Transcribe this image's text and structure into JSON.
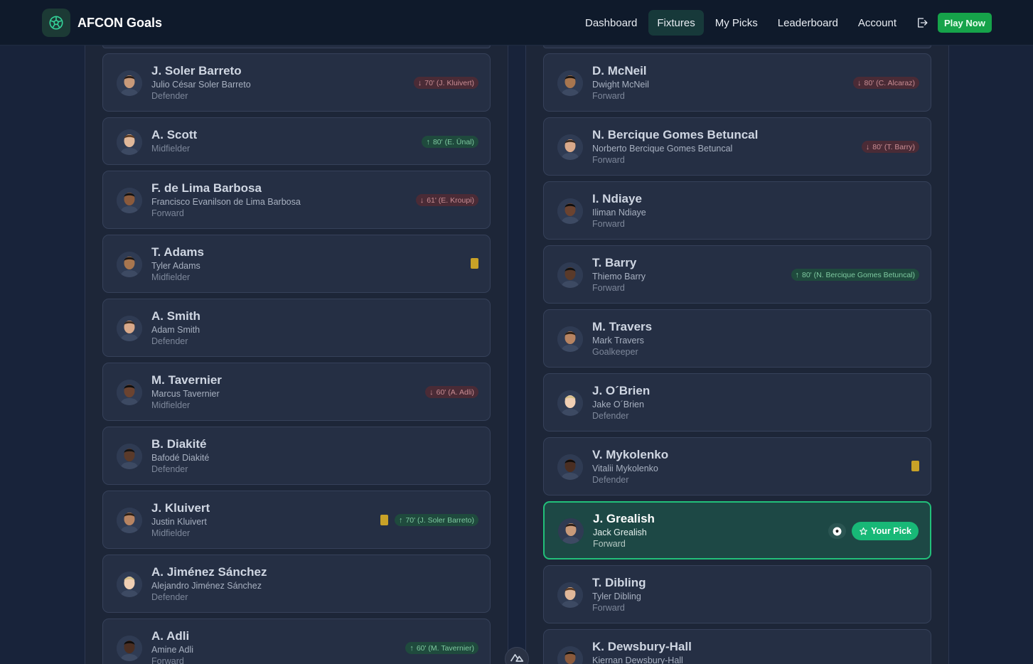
{
  "app": {
    "title": "AFCON Goals",
    "logo_icon": "soccer-ball-icon"
  },
  "nav": {
    "items": [
      {
        "label": "Dashboard",
        "active": false
      },
      {
        "label": "Fixtures",
        "active": true
      },
      {
        "label": "My Picks",
        "active": false
      },
      {
        "label": "Leaderboard",
        "active": false
      },
      {
        "label": "Account",
        "active": false
      }
    ],
    "logout_icon": "logout-icon",
    "cta_label": "Play Now"
  },
  "colors": {
    "accent": "#16a34a",
    "pick_border": "#22c07a",
    "sub_out": "#c98d93",
    "sub_in": "#7ec9a0",
    "yellow_card": "#c9a227"
  },
  "left_team": {
    "players": [
      {
        "name": "J. Soler Barreto",
        "full": "Julio César Soler Barreto",
        "position": "Defender",
        "yellow": false,
        "sub": {
          "type": "out",
          "text": "70' (J. Kluivert)"
        }
      },
      {
        "name": "A. Scott",
        "full": "",
        "position": "Midfielder",
        "yellow": false,
        "sub": {
          "type": "in",
          "text": "80' (E. Ünal)"
        }
      },
      {
        "name": "F. de Lima Barbosa",
        "full": "Francisco Evanilson de Lima Barbosa",
        "position": "Forward",
        "yellow": false,
        "sub": {
          "type": "out",
          "text": "61' (E. Kroupi)"
        }
      },
      {
        "name": "T. Adams",
        "full": "Tyler Adams",
        "position": "Midfielder",
        "yellow": true,
        "sub": null
      },
      {
        "name": "A. Smith",
        "full": "Adam Smith",
        "position": "Defender",
        "yellow": false,
        "sub": null
      },
      {
        "name": "M. Tavernier",
        "full": "Marcus Tavernier",
        "position": "Midfielder",
        "yellow": false,
        "sub": {
          "type": "out",
          "text": "60' (A. Adli)"
        }
      },
      {
        "name": "B. Diakité",
        "full": "Bafodé Diakité",
        "position": "Defender",
        "yellow": false,
        "sub": null
      },
      {
        "name": "J. Kluivert",
        "full": "Justin Kluivert",
        "position": "Midfielder",
        "yellow": true,
        "sub": {
          "type": "in",
          "text": "70' (J. Soler Barreto)"
        }
      },
      {
        "name": "A. Jiménez Sánchez",
        "full": "Alejandro Jiménez Sánchez",
        "position": "Defender",
        "yellow": false,
        "sub": null
      },
      {
        "name": "A. Adli",
        "full": "Amine Adli",
        "position": "Forward",
        "yellow": false,
        "sub": {
          "type": "in",
          "text": "60' (M. Tavernier)"
        }
      }
    ]
  },
  "right_team": {
    "players": [
      {
        "name": "D. McNeil",
        "full": "Dwight McNeil",
        "position": "Forward",
        "yellow": false,
        "sub": {
          "type": "out",
          "text": "80' (C. Alcaraz)"
        }
      },
      {
        "name": "N. Bercique Gomes Betuncal",
        "full": "Norberto Bercique Gomes Betuncal",
        "position": "Forward",
        "yellow": false,
        "sub": {
          "type": "out",
          "text": "80' (T. Barry)"
        }
      },
      {
        "name": "I. Ndiaye",
        "full": "Iliman Ndiaye",
        "position": "Forward",
        "yellow": false,
        "sub": null
      },
      {
        "name": "T. Barry",
        "full": "Thiemo Barry",
        "position": "Forward",
        "yellow": false,
        "sub": {
          "type": "in",
          "text": "80' (N. Bercique Gomes Betuncal)"
        }
      },
      {
        "name": "M. Travers",
        "full": "Mark Travers",
        "position": "Goalkeeper",
        "yellow": false,
        "sub": null
      },
      {
        "name": "J. O´Brien",
        "full": "Jake O´Brien",
        "position": "Defender",
        "yellow": false,
        "sub": null
      },
      {
        "name": "V. Mykolenko",
        "full": "Vitalii Mykolenko",
        "position": "Defender",
        "yellow": true,
        "sub": null
      },
      {
        "name": "J. Grealish",
        "full": "Jack Grealish",
        "position": "Forward",
        "yellow": false,
        "sub": null,
        "is_pick": true,
        "goal": true,
        "pick_label": "Your Pick"
      },
      {
        "name": "T. Dibling",
        "full": "Tyler Dibling",
        "position": "Forward",
        "yellow": false,
        "sub": null
      },
      {
        "name": "K. Dewsbury-Hall",
        "full": "Kiernan Dewsbury-Hall",
        "position": "",
        "yellow": false,
        "sub": null
      }
    ]
  },
  "devtools_icon": "nuxt-devtools-icon"
}
